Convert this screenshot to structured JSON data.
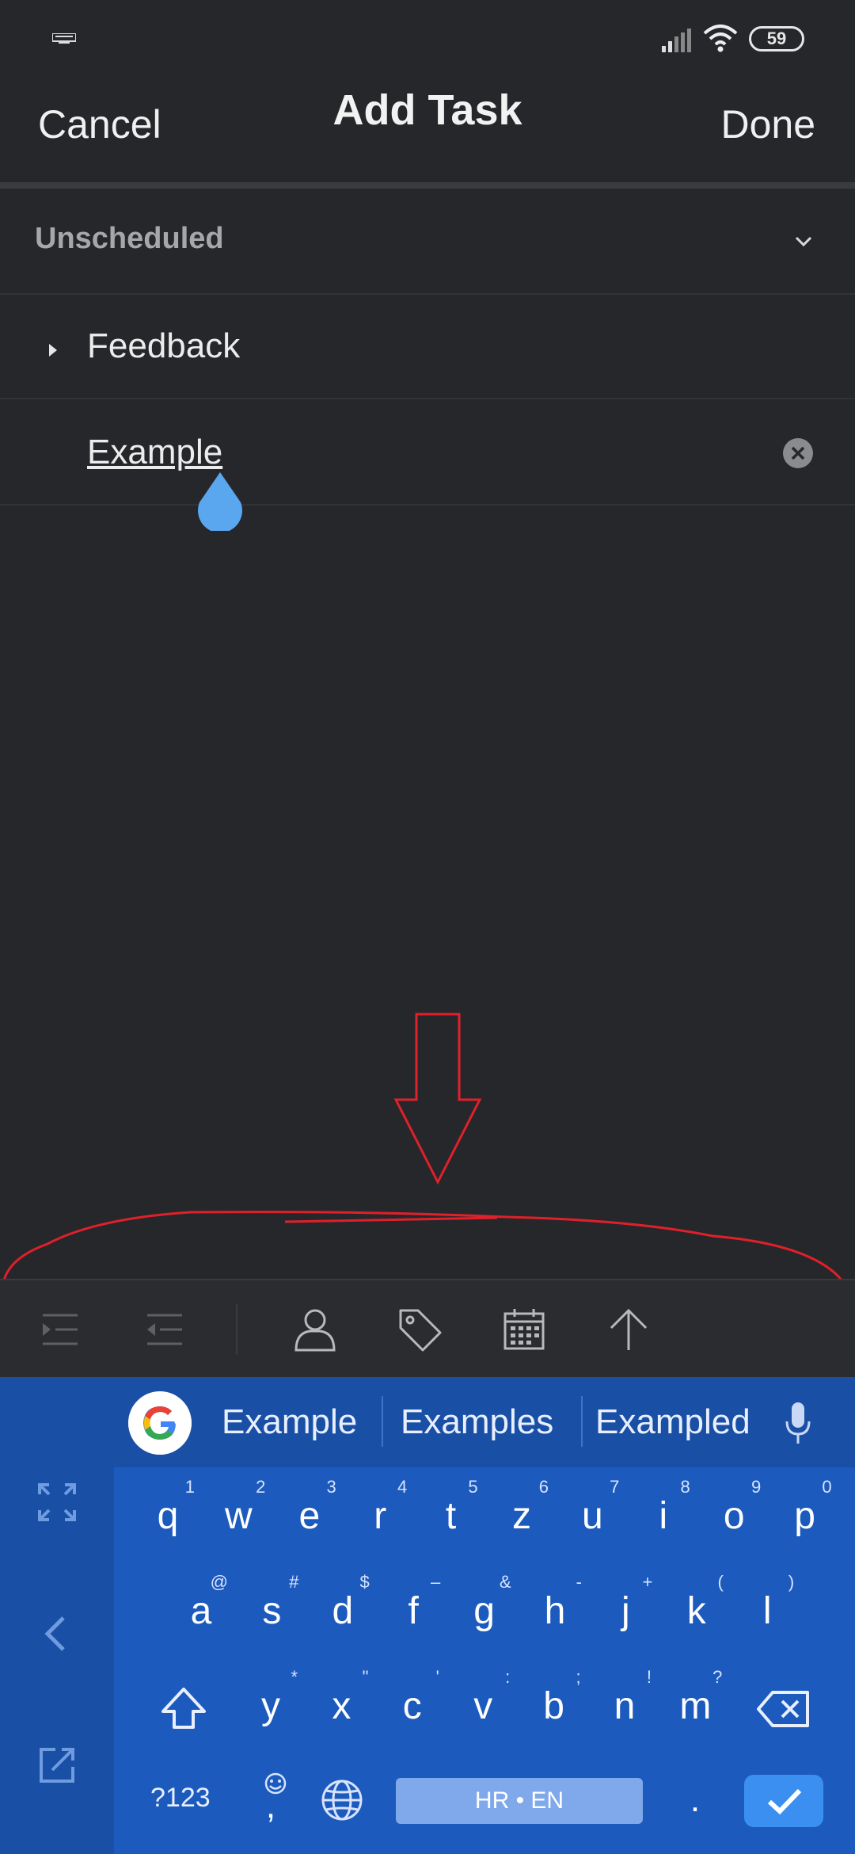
{
  "status_bar": {
    "battery": "59"
  },
  "header": {
    "cancel_label": "Cancel",
    "title": "Add Task",
    "done_label": "Done"
  },
  "list": {
    "section_label": "Unscheduled",
    "parent_task": "Feedback",
    "new_task_value": "Example"
  },
  "toolbar": {
    "icons": [
      "indent-icon",
      "outdent-icon",
      "assign-person-icon",
      "tag-icon",
      "calendar-icon",
      "move-up-icon"
    ]
  },
  "keyboard": {
    "suggestions": [
      "Example",
      "Examples",
      "Exampled"
    ],
    "row1": [
      {
        "k": "q",
        "h": "1"
      },
      {
        "k": "w",
        "h": "2"
      },
      {
        "k": "e",
        "h": "3"
      },
      {
        "k": "r",
        "h": "4"
      },
      {
        "k": "t",
        "h": "5"
      },
      {
        "k": "z",
        "h": "6"
      },
      {
        "k": "u",
        "h": "7"
      },
      {
        "k": "i",
        "h": "8"
      },
      {
        "k": "o",
        "h": "9"
      },
      {
        "k": "p",
        "h": "0"
      }
    ],
    "row2": [
      {
        "k": "a",
        "h": "@"
      },
      {
        "k": "s",
        "h": "#"
      },
      {
        "k": "d",
        "h": "$"
      },
      {
        "k": "f",
        "h": "–"
      },
      {
        "k": "g",
        "h": "&"
      },
      {
        "k": "h",
        "h": "-"
      },
      {
        "k": "j",
        "h": "+"
      },
      {
        "k": "k",
        "h": "("
      },
      {
        "k": "l",
        "h": ")"
      }
    ],
    "row3": [
      {
        "k": "y",
        "h": "*"
      },
      {
        "k": "x",
        "h": "\""
      },
      {
        "k": "c",
        "h": "'"
      },
      {
        "k": "v",
        "h": ":"
      },
      {
        "k": "b",
        "h": ";"
      },
      {
        "k": "n",
        "h": "!"
      },
      {
        "k": "m",
        "h": "?"
      }
    ],
    "symbols_label": "?123",
    "comma_label": ",",
    "space_label": "HR • EN",
    "period_label": "."
  },
  "colors": {
    "background": "#26272b",
    "keyboard": "#1c5bbd",
    "accent": "#3a8ff0",
    "annotation": "#e0202a"
  }
}
